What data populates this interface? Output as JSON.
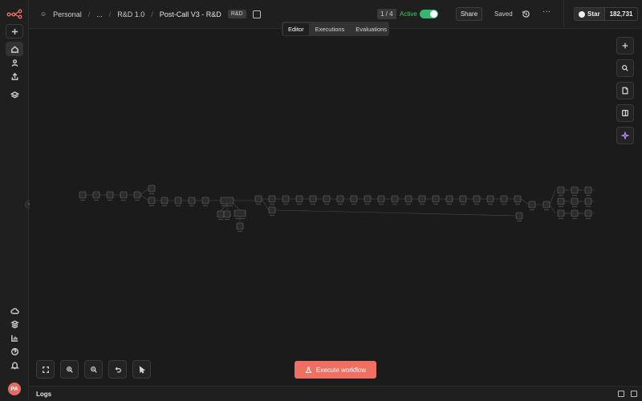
{
  "header": {
    "breadcrumb": [
      "Personal",
      "...",
      "R&D 1.0"
    ],
    "workflow_title": "Post-Call V3 - R&D",
    "tag": "R&D",
    "version_counter": "1 / 4",
    "active_label": "Active",
    "active_state": true,
    "share_label": "Share",
    "saved_label": "Saved",
    "github": {
      "star_label": "Star",
      "star_count": "182,731"
    }
  },
  "tabs": [
    {
      "label": "Editor",
      "selected": true
    },
    {
      "label": "Executions",
      "selected": false
    },
    {
      "label": "Evaluations",
      "selected": false
    }
  ],
  "rail": {
    "avatar_initials": "PA",
    "top_icons": [
      "plus-icon",
      "home-icon",
      "user-icon",
      "share-icon",
      "layers-icon"
    ],
    "bottom_icons": [
      "cloud-icon",
      "templates-icon",
      "insights-icon",
      "help-icon",
      "bell-icon"
    ]
  },
  "right_tools": [
    "add-node-icon",
    "search-icon",
    "sticky-note-icon",
    "panel-icon",
    "ai-sparkle-icon"
  ],
  "bottom_tools": [
    "fit-view-icon",
    "zoom-in-icon",
    "zoom-out-icon",
    "reset-zoom-icon",
    "tidy-up-icon"
  ],
  "execute_label": "Execute workflow",
  "logs_label": "Logs",
  "colors": {
    "accent": "#ef6f63",
    "active_green": "#35b86b",
    "ai": "#b58cff",
    "background": "#1b1b1b"
  }
}
